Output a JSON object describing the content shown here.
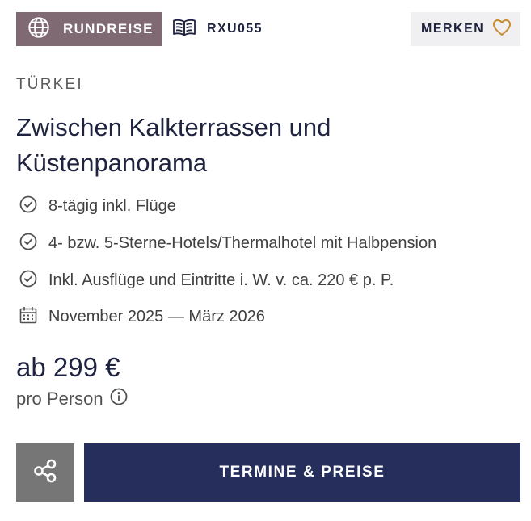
{
  "header": {
    "tour_type_label": "RUNDREISE",
    "tour_type_icon": "globe-icon",
    "tour_code": "RXU055",
    "tour_code_icon": "open-book-icon",
    "save_label": "MERKEN",
    "save_icon": "heart-icon"
  },
  "destination": "TÜRKEI",
  "title": "Zwischen Kalkterrassen und Küstenpanorama",
  "features": [
    {
      "icon": "check-circle-icon",
      "text": "8-tägig inkl. Flüge"
    },
    {
      "icon": "check-circle-icon",
      "text": "4- bzw. 5-Sterne-Hotels/Thermalhotel mit Halbpension"
    },
    {
      "icon": "check-circle-icon",
      "text": "Inkl. Ausflüge und Eintritte i. W. v. ca. 220 € p. P."
    },
    {
      "icon": "calendar-icon",
      "text": "November 2025 — März 2026"
    }
  ],
  "price": {
    "amount_text": "ab 299 €",
    "unit_text": "pro Person",
    "info_icon": "info-icon"
  },
  "actions": {
    "share_icon": "share-icon",
    "cta_label": "TERMINE & PREISE"
  },
  "colors": {
    "badge_bg": "#7f6a73",
    "cta_bg": "#262f5c",
    "share_bg": "#767676",
    "heart": "#c98a2e",
    "heading": "#1f2340"
  }
}
